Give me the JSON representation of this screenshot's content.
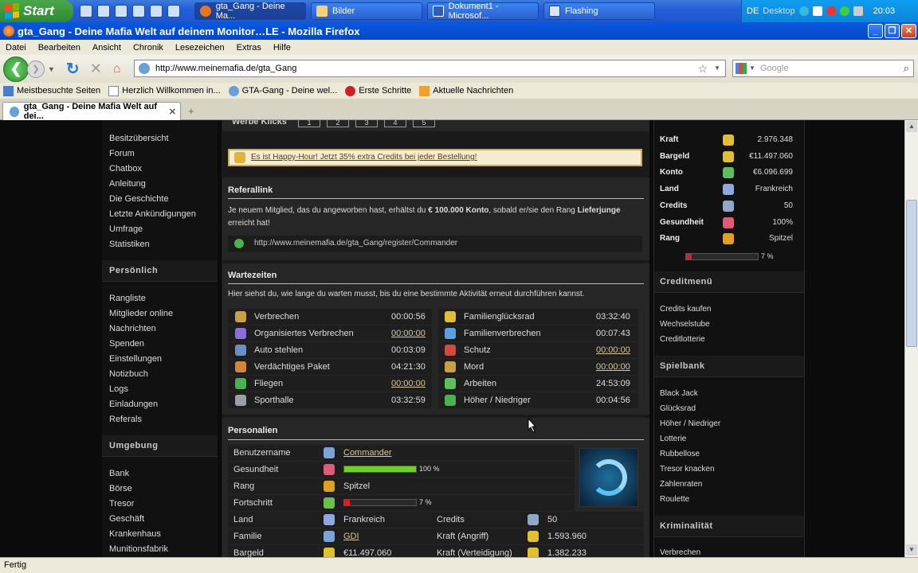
{
  "taskbar": {
    "start_label": "Start",
    "tasks": [
      {
        "label": "gta_Gang - Deine Ma...",
        "active": true
      },
      {
        "label": "Bilder",
        "active": false
      },
      {
        "label": "Dokument1 - Microsof...",
        "active": false
      },
      {
        "label": "Flashing",
        "active": false
      }
    ],
    "tray": {
      "lang": "DE",
      "desktop": "Desktop",
      "clock": "20:03"
    }
  },
  "window": {
    "title": "gta_Gang - Deine Mafia Welt auf deinem Monitor…LE - Mozilla Firefox",
    "menu": [
      "Datei",
      "Bearbeiten",
      "Ansicht",
      "Chronik",
      "Lesezeichen",
      "Extras",
      "Hilfe"
    ],
    "url": "http://www.meinemafia.de/gta_Gang",
    "search_placeholder": "Google",
    "bookmarks": [
      "Meistbesuchte Seiten",
      "Herzlich Willkommen in...",
      "GTA-Gang - Deine wel...",
      "Erste Schritte",
      "Aktuelle Nachrichten"
    ],
    "tab_label": "gta_Gang - Deine Mafia Welt auf dei...",
    "status": "Fertig"
  },
  "left_nav": {
    "top_items": [
      "Besitzübersicht",
      "Forum",
      "Chatbox",
      "Anleitung",
      "Die Geschichte",
      "Letzte Ankündigungen",
      "Umfrage",
      "Statistiken"
    ],
    "personal_title": "Persönlich",
    "personal_items": [
      "Rangliste",
      "Mitglieder online",
      "Nachrichten",
      "Spenden",
      "Einstellungen",
      "Notizbuch",
      "Logs",
      "Einladungen",
      "Referals"
    ],
    "env_title": "Umgebung",
    "env_items": [
      "Bank",
      "Börse",
      "Tresor",
      "Geschäft",
      "Krankenhaus",
      "Munitionsfabrik"
    ]
  },
  "main": {
    "werbe_label": "Werbe Klicks",
    "werbe_buttons": [
      "1",
      "2",
      "3",
      "4",
      "5"
    ],
    "happy_hour": "Es ist Happy-Hour! Jetzt 35% extra Credits bei jeder Bestellung!",
    "referal": {
      "title": "Referallink",
      "text_a": "Je neuem Mitglied, das du angeworben hast, erhältst du ",
      "text_b": "€ 100.000 Konto",
      "text_c": ", sobald er/sie den Rang ",
      "text_d": "Lieferjunge",
      "text_e": "erreicht hat!",
      "link": "http://www.meinemafia.de/gta_Gang/register/Commander"
    },
    "wartezeiten": {
      "title": "Wartezeiten",
      "intro": "Hier siehst du, wie lange du warten musst, bis du eine bestimmte Aktivität erneut durchführen kannst.",
      "left": [
        {
          "name": "Verbrechen",
          "time": "00:00:56",
          "link": false
        },
        {
          "name": "Organisiertes Verbrechen",
          "time": "00:00:00",
          "link": true
        },
        {
          "name": "Auto stehlen",
          "time": "00:03:09",
          "link": false
        },
        {
          "name": "Verdächtiges Paket",
          "time": "04:21:30",
          "link": false
        },
        {
          "name": "Fliegen",
          "time": "00:00:00",
          "link": true
        },
        {
          "name": "Sporthalle",
          "time": "03:32:59",
          "link": false
        }
      ],
      "right": [
        {
          "name": "Familienglücksrad",
          "time": "03:32:40",
          "link": false
        },
        {
          "name": "Familienverbrechen",
          "time": "00:07:43",
          "link": false
        },
        {
          "name": "Schutz",
          "time": "00:00:00",
          "link": true
        },
        {
          "name": "Mord",
          "time": "00:00:00",
          "link": true
        },
        {
          "name": "Arbeiten",
          "time": "24:53:09",
          "link": false
        },
        {
          "name": "Höher / Niedriger",
          "time": "00:04:56",
          "link": false
        }
      ]
    },
    "personalien": {
      "title": "Personalien",
      "benutzername_label": "Benutzername",
      "benutzername": "Commander",
      "gesundheit_label": "Gesundheit",
      "gesundheit": "100 %",
      "gesundheit_value": 1.0,
      "rang_label": "Rang",
      "rang": "Spitzel",
      "fortschritt_label": "Fortschritt",
      "fortschritt": "7 %",
      "fortschritt_value": 0.07,
      "land_label": "Land",
      "land": "Frankreich",
      "credits_label": "Credits",
      "credits": "50",
      "familie_label": "Familie",
      "familie": "GDI",
      "kraft_a_label": "Kraft (Angriff)",
      "kraft_a": "1.593.960",
      "bargeld_label": "Bargeld",
      "bargeld": "€11.497.060",
      "kraft_v_label": "Kraft (Verteidigung)",
      "kraft_v": "1.382.233"
    }
  },
  "right": {
    "stats": [
      {
        "label": "Kraft",
        "value": "2.976.348"
      },
      {
        "label": "Bargeld",
        "value": "€11.497.060"
      },
      {
        "label": "Konto",
        "value": "€6.096.699"
      },
      {
        "label": "Land",
        "value": "Frankreich"
      },
      {
        "label": "Credits",
        "value": "50"
      },
      {
        "label": "Gesundheit",
        "value": "100%"
      },
      {
        "label": "Rang",
        "value": "Spitzel"
      }
    ],
    "rank_progress": "7 %",
    "rank_progress_value": 0.07,
    "creditmenu_title": "Creditmenü",
    "creditmenu_items": [
      "Credits kaufen",
      "Wechselstube",
      "Creditlotterie"
    ],
    "spielbank_title": "Spielbank",
    "spielbank_items": [
      "Black Jack",
      "Glücksrad",
      "Höher / Niedriger",
      "Lotterie",
      "Rubbellose",
      "Tresor knacken",
      "Zahlenraten",
      "Roulette"
    ],
    "krim_title": "Kriminalität",
    "krim_items": [
      "Verbrechen"
    ]
  }
}
